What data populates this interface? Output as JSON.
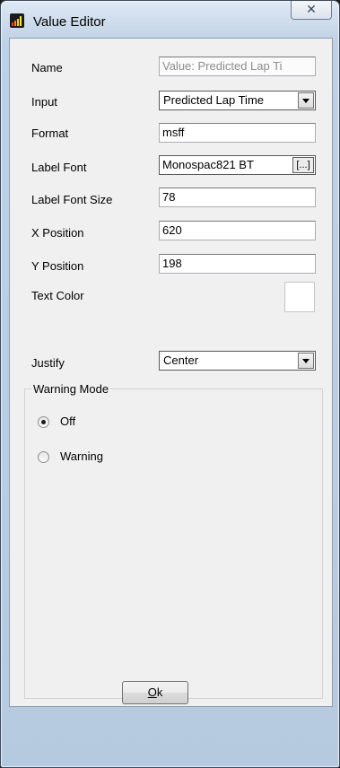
{
  "window": {
    "title": "Value Editor",
    "close_glyph": "✕"
  },
  "form": {
    "name_label": "Name",
    "name_value": "Value: Predicted Lap Ti",
    "input_label": "Input",
    "input_value": "Predicted Lap Time",
    "format_label": "Format",
    "format_value": "msff",
    "label_font_label": "Label Font",
    "label_font_value": "Monospac821 BT",
    "label_font_button": "[...]",
    "label_font_size_label": "Label Font Size",
    "label_font_size_value": "78",
    "x_position_label": "X Position",
    "x_position_value": "620",
    "y_position_label": "Y Position",
    "y_position_value": "198",
    "text_color_label": "Text Color",
    "text_color_value": "#ffffff",
    "justify_label": "Justify",
    "justify_value": "Center"
  },
  "warning_mode": {
    "title": "Warning Mode",
    "options": [
      {
        "label": "Off",
        "selected": true
      },
      {
        "label": "Warning",
        "selected": false
      }
    ]
  },
  "footer": {
    "ok_label_underlined": "O",
    "ok_label_rest": "k"
  }
}
